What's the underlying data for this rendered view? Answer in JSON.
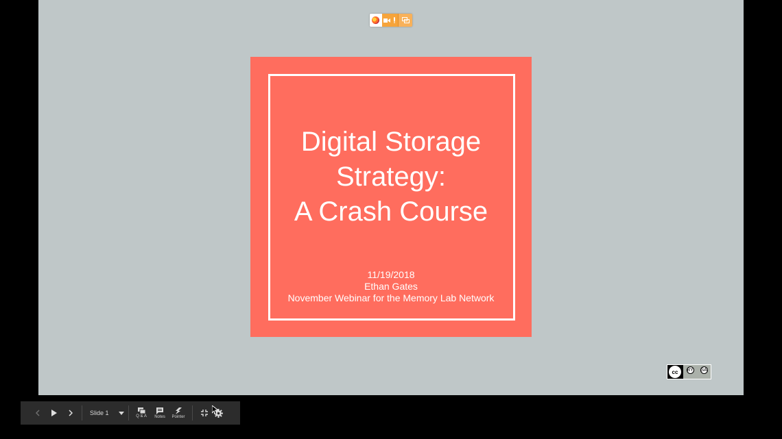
{
  "share_indicator": {
    "icons": [
      "firefox-icon",
      "camera-icon",
      "microphone-icon",
      "screen-share-icon"
    ],
    "accent": "#f6a43b"
  },
  "slide": {
    "title_lines": [
      "Digital Storage",
      "Strategy:",
      "A Crash Course"
    ],
    "date": "11/19/2018",
    "author": "Ethan Gates",
    "event": "November Webinar for the Memory Lab Network",
    "background": "#ff6d5e",
    "text_color": "#ffffff"
  },
  "license": {
    "badge_text": [
      "BY",
      "SA"
    ],
    "cc": "cc"
  },
  "toolbar": {
    "slide_label": "Slide 1",
    "qa_label": "Q & A",
    "notes_label": "Notes",
    "pointer_label": "Pointer"
  },
  "colors": {
    "stage": "#bfc7c8",
    "toolbar": "#2c2c2c"
  }
}
